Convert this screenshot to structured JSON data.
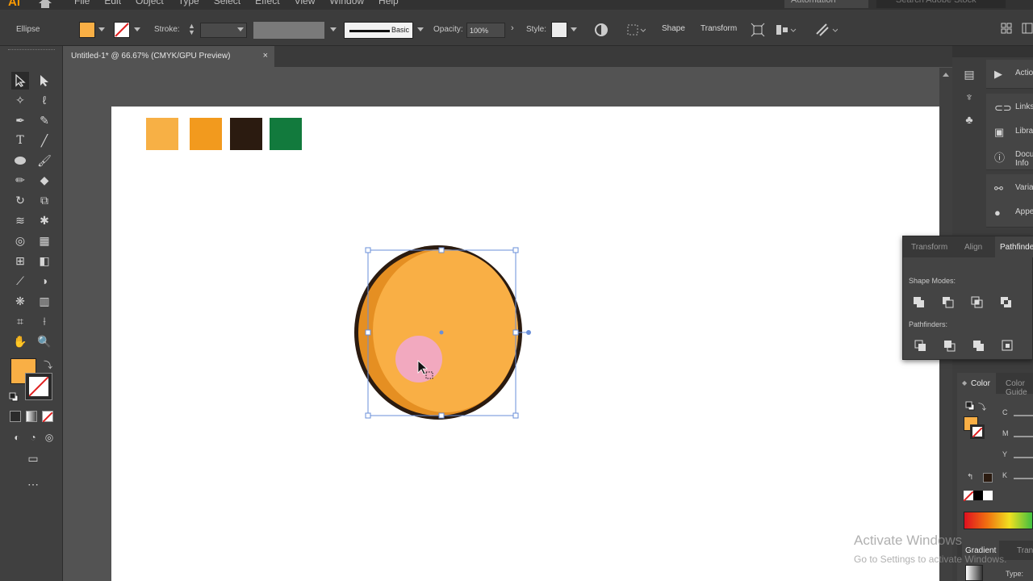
{
  "menubar": {
    "logo": "Ai",
    "items": [
      "File",
      "Edit",
      "Object",
      "Type",
      "Select",
      "Effect",
      "View",
      "Window",
      "Help"
    ],
    "workspace": "Automation",
    "search_placeholder": "Search Adobe Stock"
  },
  "control_bar": {
    "selection_type": "Ellipse",
    "stroke_label": "Stroke:",
    "brush_profile": "Basic",
    "opacity_label": "Opacity:",
    "opacity_value": "100%",
    "style_label": "Style:",
    "shape_button": "Shape",
    "transform_button": "Transform"
  },
  "document_tab": {
    "title": "Untitled-1* @ 66.67% (CMYK/GPU Preview)",
    "close": "×"
  },
  "colors": {
    "fill": "#F9AF45",
    "swatch_light_orange": "#F7B045",
    "swatch_orange": "#F29A1E",
    "swatch_dark_brown": "#2B1B10",
    "swatch_green": "#127A3D",
    "orange_outline": "#2B1B10",
    "orange_shadow": "#E58F22",
    "blush": "#F2A9BF",
    "leaf": "#127A3D",
    "selection": "#6A8FD8"
  },
  "right_dock": {
    "items": [
      {
        "label": "Actions",
        "icon": "play-icon"
      },
      {
        "label": "Links",
        "icon": "link-icon"
      },
      {
        "label": "Libraries",
        "icon": "library-icon"
      },
      {
        "label": "Document Info",
        "icon": "document-icon"
      },
      {
        "label": "Variables",
        "icon": "variables-icon"
      },
      {
        "label": "Appearance",
        "icon": "appearance-icon"
      }
    ]
  },
  "pathfinder_panel": {
    "tabs": [
      "Transform",
      "Align",
      "Pathfinder"
    ],
    "shape_modes_label": "Shape Modes:",
    "pathfinders_label": "Pathfinders:"
  },
  "color_panel": {
    "tabs": [
      "Color",
      "Color Guide"
    ],
    "channels": [
      "C",
      "M",
      "Y",
      "K"
    ],
    "bottom_tabs": [
      "Gradient",
      "Transparency"
    ],
    "type_label": "Type:"
  },
  "watermark": {
    "title": "Activate Windows",
    "subtitle": "Go to Settings to activate Windows."
  }
}
